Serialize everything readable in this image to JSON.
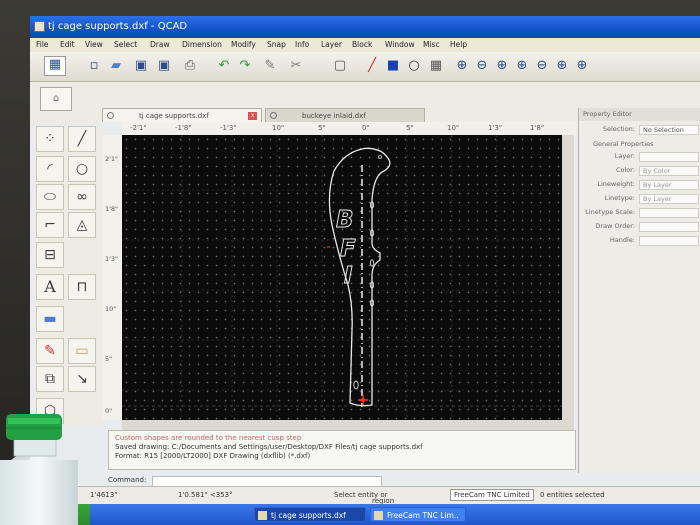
{
  "window": {
    "title": "tj cage supports.dxf - QCAD"
  },
  "menu": [
    "File",
    "Edit",
    "View",
    "Select",
    "Draw",
    "Dimension",
    "Modify",
    "Snap",
    "Info",
    "Layer",
    "Block",
    "Window",
    "Misc",
    "Help"
  ],
  "toolbar_icons": [
    "new-icon",
    "open-icon",
    "save-icon",
    "save-as-icon",
    "print-icon",
    "undo-icon",
    "redo-icon",
    "pencil-icon",
    "cut-icon",
    "clipboard-icon",
    "pen-icon",
    "color-box-icon",
    "circle-icon",
    "grid-icon",
    "zoom-in-icon",
    "zoom-out-icon",
    "zoom-window-icon",
    "zoom-auto-icon",
    "zoom-previous-icon",
    "zoom-redraw-icon",
    "zoom-pan-icon"
  ],
  "tabs": [
    {
      "label": "tj cage supports.dxf",
      "active": true
    },
    {
      "label": "buckeye inlaid.dxf",
      "active": false
    }
  ],
  "rulers": {
    "top": [
      "-2'1\"",
      "-1'8\"",
      "-1'3\"",
      "10\"",
      "5\"",
      "0\"",
      "5\"",
      "10\"",
      "1'3\"",
      "1'8\""
    ],
    "left": [
      "2'1\"",
      "1'8\"",
      "1'3\"",
      "10\"",
      "5\"",
      "0\""
    ]
  },
  "drawing": {
    "letters": [
      "B",
      "F",
      "I"
    ]
  },
  "property_editor": {
    "title": "Property Editor",
    "selection_label": "Selection:",
    "selection_value": "No Selection",
    "section": "General Properties",
    "fields": [
      {
        "label": "Layer:",
        "value": ""
      },
      {
        "label": "Color:",
        "value": "By Color"
      },
      {
        "label": "Lineweight:",
        "value": "By Layer"
      },
      {
        "label": "Linetype:",
        "value": "By Layer"
      },
      {
        "label": "Linetype Scale:",
        "value": ""
      },
      {
        "label": "Draw Order:",
        "value": ""
      },
      {
        "label": "Handle:",
        "value": ""
      }
    ]
  },
  "command_log": {
    "lines": [
      "Custom shapes are rounded to the nearest cusp step",
      "Saved drawing: C:/Documents and Settings/user/Desktop/DXF Files/tj cage supports.dxf",
      "Format: R15 [2000/LT2000] DXF Drawing (dxflib) (*.dxf)"
    ]
  },
  "command": {
    "label": "Command:"
  },
  "status": {
    "coord_abs": "1'4613\"",
    "coord_rel": "1'0.581\" <353°",
    "hint": "Select entity or",
    "hint2": "region",
    "snap_mode": "FreeCam TNC Limited",
    "selected": "0 entities selected"
  },
  "taskbar": {
    "start": "start",
    "items": [
      {
        "label": "tj cage supports.dxf",
        "active": true
      },
      {
        "label": "FreeCam TNC Lim..",
        "active": false
      }
    ]
  },
  "colors": {
    "canvas": "#0b0b0b",
    "title_bar": "#1552c9",
    "outline": "#e8e8e8",
    "accent_red": "#ff3030"
  }
}
